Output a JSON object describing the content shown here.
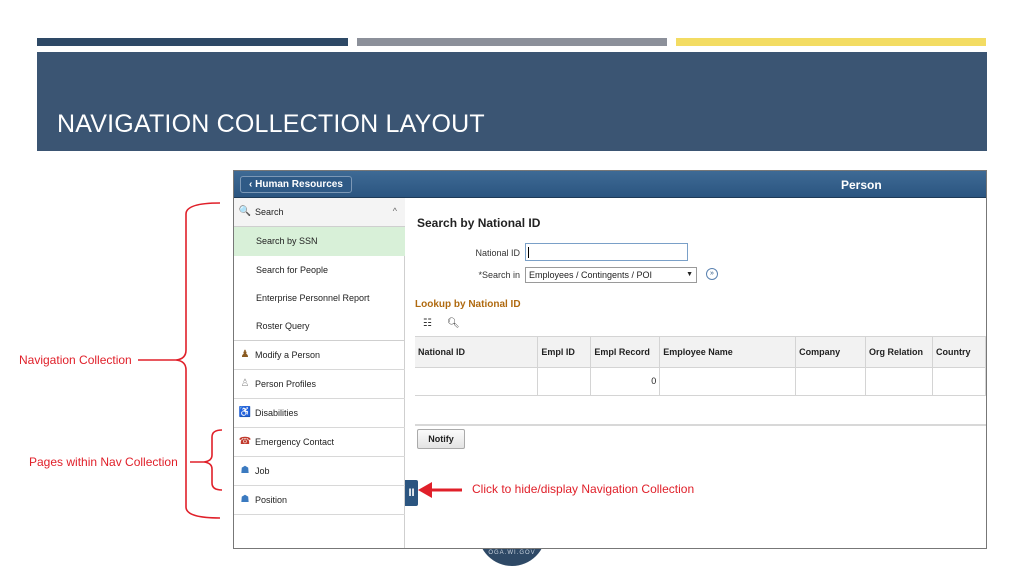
{
  "slide": {
    "title": "NAVIGATION COLLECTION LAYOUT",
    "colors": {
      "bar_navy": "#2e4966",
      "bar_gray": "#8c909a",
      "bar_yellow": "#f3dc63",
      "header_bg": "#3b5573",
      "annotation_red": "#e0202a"
    }
  },
  "app": {
    "back_button": "Human Resources",
    "back_icon": "chevron-left-icon",
    "page_name": "Person"
  },
  "nav": {
    "search_folder": {
      "label": "Search",
      "icon": "search-folder-icon"
    },
    "search_items": [
      "Search by SSN",
      "Search for People",
      "Enterprise Personnel Report",
      "Roster Query"
    ],
    "items": [
      {
        "label": "Modify a Person",
        "icon": "person-edit-icon"
      },
      {
        "label": "Person Profiles",
        "icon": "person-profile-icon"
      },
      {
        "label": "Disabilities",
        "icon": "disabilities-icon"
      },
      {
        "label": "Emergency Contact",
        "icon": "emergency-contact-icon"
      },
      {
        "label": "Job",
        "icon": "job-icon"
      },
      {
        "label": "Position",
        "icon": "position-icon"
      }
    ]
  },
  "main": {
    "title": "Search by National ID",
    "national_id_label": "National ID",
    "search_in_label": "*Search in",
    "search_in_value": "Employees / Contingents / POI",
    "lookup_title": "Lookup by National ID",
    "columns": [
      "National ID",
      "Empl ID",
      "Empl Record",
      "Employee Name",
      "Company",
      "Org Relation",
      "Country"
    ],
    "row": [
      "",
      "",
      "0",
      "",
      "",
      "",
      ""
    ],
    "notify_label": "Notify"
  },
  "annotations": {
    "nav_collection": "Navigation Collection",
    "pages_within": "Pages within Nav Collection",
    "hide_display": "Click to hide/display Navigation Collection"
  },
  "seal": {
    "text": "OGA.WI.GOV"
  }
}
